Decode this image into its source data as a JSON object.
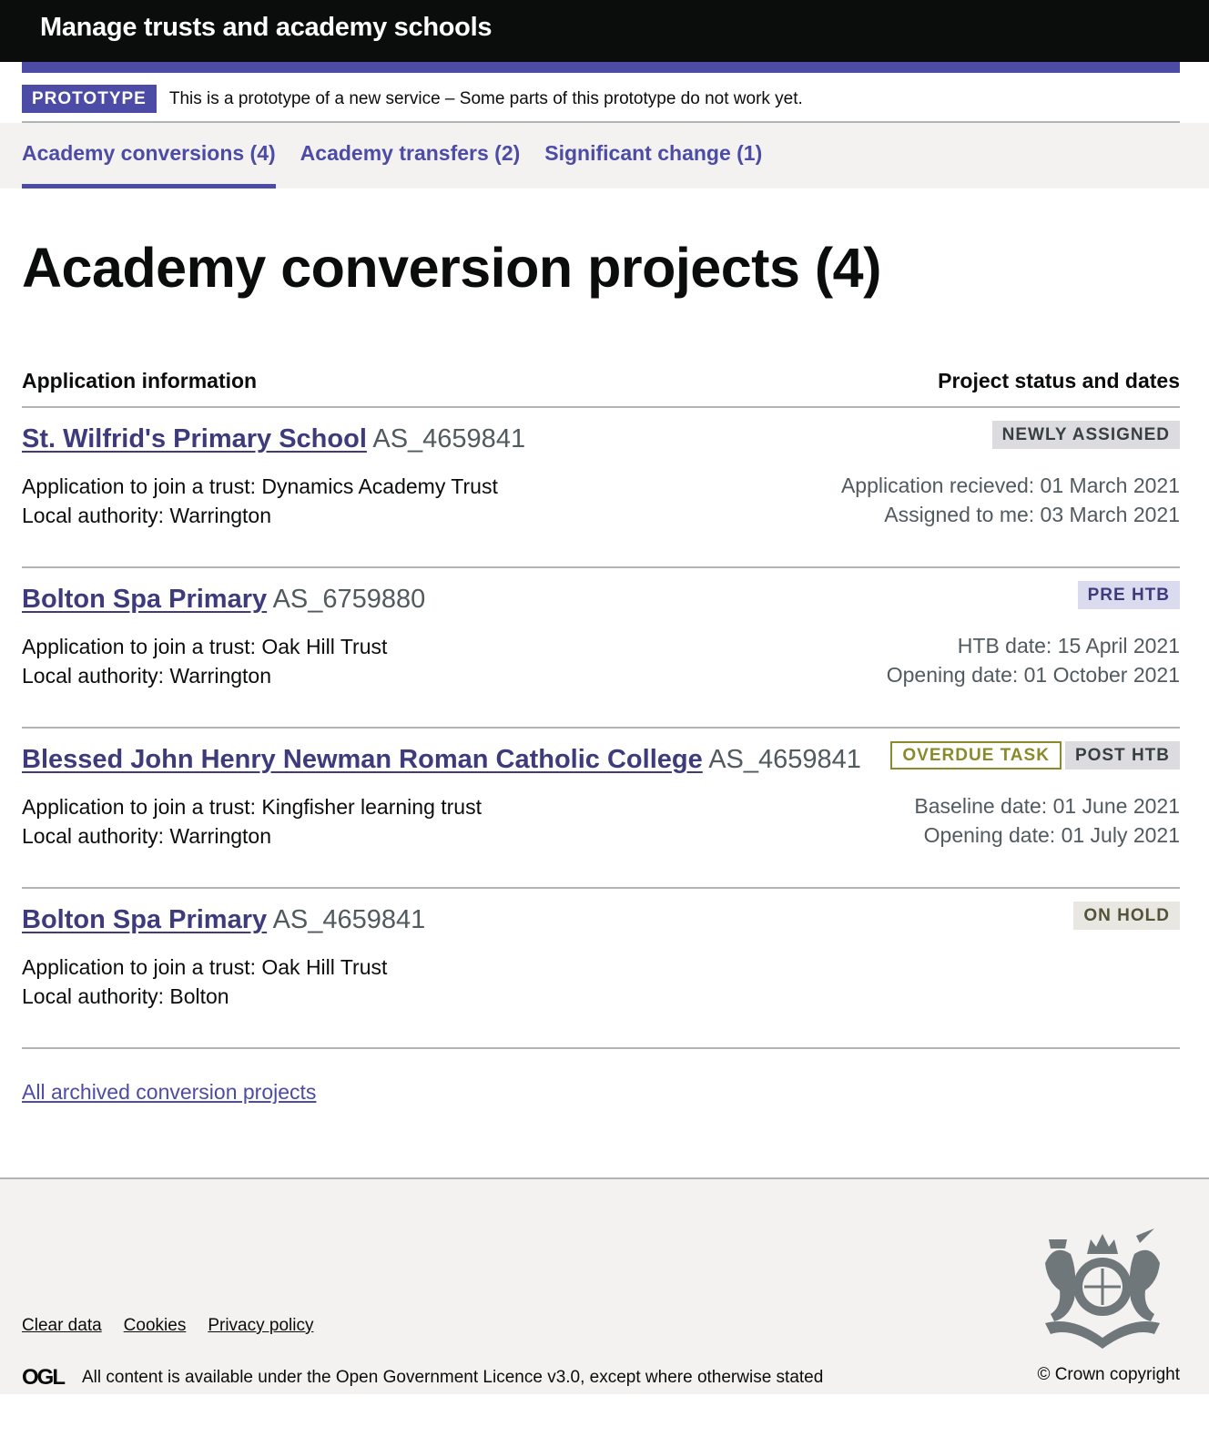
{
  "header": {
    "title": "Manage trusts and academy schools"
  },
  "phase_banner": {
    "tag": "PROTOTYPE",
    "text": "This is a prototype of a new service – Some parts of this prototype do not work yet."
  },
  "tabs": [
    {
      "label": "Academy conversions (4)",
      "active": true
    },
    {
      "label": "Academy transfers (2)",
      "active": false
    },
    {
      "label": "Significant change (1)",
      "active": false
    }
  ],
  "page_title": "Academy conversion projects (4)",
  "list_headers": {
    "left": "Application information",
    "right": "Project status and dates"
  },
  "projects": [
    {
      "name": "St. Wilfrid's Primary School",
      "ref": "AS_4659841",
      "trust": "Application to join a trust: Dynamics Academy Trust",
      "authority": "Local authority: Warrington",
      "tags": [
        {
          "label": "NEWLY ASSIGNED",
          "style": "grey"
        }
      ],
      "dates": [
        "Application recieved: 01 March 2021",
        "Assigned to me: 03 March 2021"
      ]
    },
    {
      "name": "Bolton Spa Primary",
      "ref": "AS_6759880",
      "trust": "Application to join a trust: Oak Hill Trust",
      "authority": "Local authority: Warrington",
      "tags": [
        {
          "label": "PRE HTB",
          "style": "purple"
        }
      ],
      "dates": [
        "HTB date: 15 April 2021",
        "Opening date: 01 October 2021"
      ]
    },
    {
      "name": "Blessed John Henry Newman Roman Catholic College",
      "ref": "AS_4659841",
      "trust": "Application to join a trust: Kingfisher learning trust",
      "authority": "Local authority: Warrington",
      "tags": [
        {
          "label": "OVERDUE TASK",
          "style": "olive"
        },
        {
          "label": "POST HTB",
          "style": "grey"
        }
      ],
      "dates": [
        "Baseline date: 01 June 2021",
        "Opening date: 01 July 2021"
      ]
    },
    {
      "name": "Bolton Spa Primary",
      "ref": "AS_4659841",
      "trust": "Application to join a trust: Oak Hill Trust",
      "authority": "Local authority: Bolton",
      "tags": [
        {
          "label": "ON HOLD",
          "style": "stone"
        }
      ],
      "dates": []
    }
  ],
  "archived_link": "All archived conversion projects",
  "footer": {
    "links": [
      "Clear data",
      "Cookies",
      "Privacy policy"
    ],
    "ogl_logo": "OGL",
    "licence_text": "All content is available under the Open Government Licence v3.0, except where otherwise stated",
    "copyright": "© Crown copyright"
  }
}
